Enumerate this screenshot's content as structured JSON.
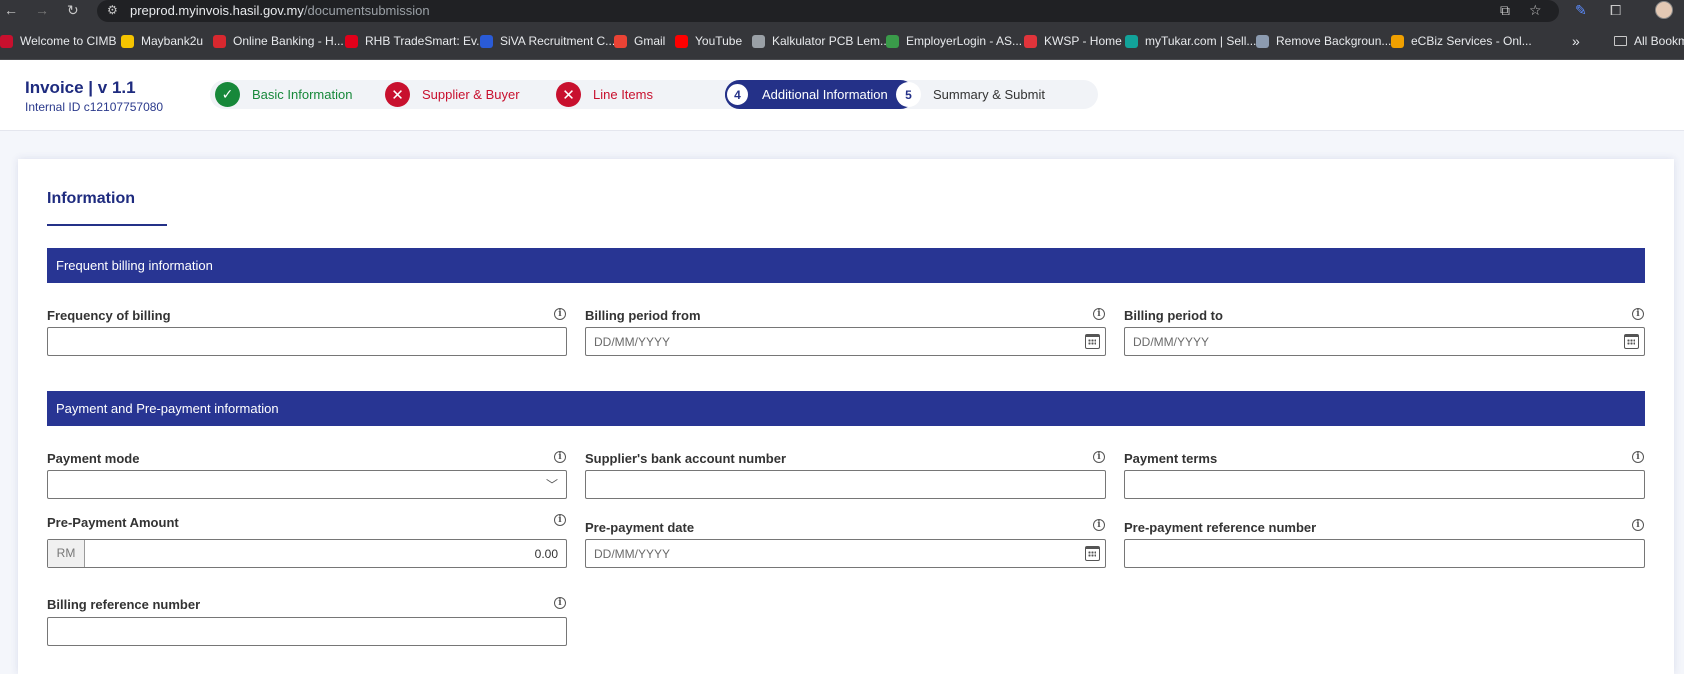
{
  "browser": {
    "url_host": "preprod.myinvois.hasil.gov.my",
    "url_path": "/documentsubmission",
    "bookmarks": [
      {
        "label": "Welcome to CIMB",
        "color": "#c8102e"
      },
      {
        "label": "Maybank2u",
        "color": "#f5c400"
      },
      {
        "label": "Online Banking - H...",
        "color": "#d8282f"
      },
      {
        "label": "RHB TradeSmart: Ev...",
        "color": "#e2001a"
      },
      {
        "label": "SiVA Recruitment C...",
        "color": "#2a5bd7"
      },
      {
        "label": "Gmail",
        "color": "#ea4335"
      },
      {
        "label": "YouTube",
        "color": "#ff0000"
      },
      {
        "label": "Kalkulator PCB Lem...",
        "color": "#9aa0a6"
      },
      {
        "label": "EmployerLogin - AS...",
        "color": "#3a9b4a"
      },
      {
        "label": "KWSP - Home",
        "color": "#e0343b"
      },
      {
        "label": "myTukar.com | Sell...",
        "color": "#12a39a"
      },
      {
        "label": "Remove Backgroun...",
        "color": "#8c9bb0"
      },
      {
        "label": "eCBiz Services - Onl...",
        "color": "#f0a000"
      }
    ],
    "more": "»",
    "all_bookmarks": "All Bookm"
  },
  "header": {
    "title": "Invoice | v 1.1",
    "internal_id": "Internal ID c12107757080"
  },
  "steps": [
    {
      "label": "Basic Information",
      "status": "complete",
      "marker": "✓"
    },
    {
      "label": "Supplier & Buyer",
      "status": "error",
      "marker": "✕"
    },
    {
      "label": "Line Items",
      "status": "error",
      "marker": "✕"
    },
    {
      "label": "Additional Information",
      "status": "active",
      "marker": "4"
    },
    {
      "label": "Summary & Submit",
      "status": "pending",
      "marker": "5"
    }
  ],
  "tab": {
    "label": "Information"
  },
  "sections": {
    "billing": {
      "title": "Frequent billing information",
      "frequency_label": "Frequency of billing",
      "period_from_label": "Billing period from",
      "period_to_label": "Billing period to",
      "date_placeholder": "DD/MM/YYYY"
    },
    "payment": {
      "title": "Payment and Pre-payment information",
      "mode_label": "Payment mode",
      "bank_account_label": "Supplier's bank account number",
      "terms_label": "Payment terms",
      "prepay_amount_label": "Pre-Payment Amount",
      "currency": "RM",
      "prepay_amount_value": "0.00",
      "prepay_date_label": "Pre-payment date",
      "prepay_ref_label": "Pre-payment reference number",
      "billing_ref_label": "Billing reference number",
      "date_placeholder": "DD/MM/YYYY"
    }
  },
  "colors": {
    "primary": "#283593",
    "success": "#17883a",
    "error": "#c8102e"
  }
}
